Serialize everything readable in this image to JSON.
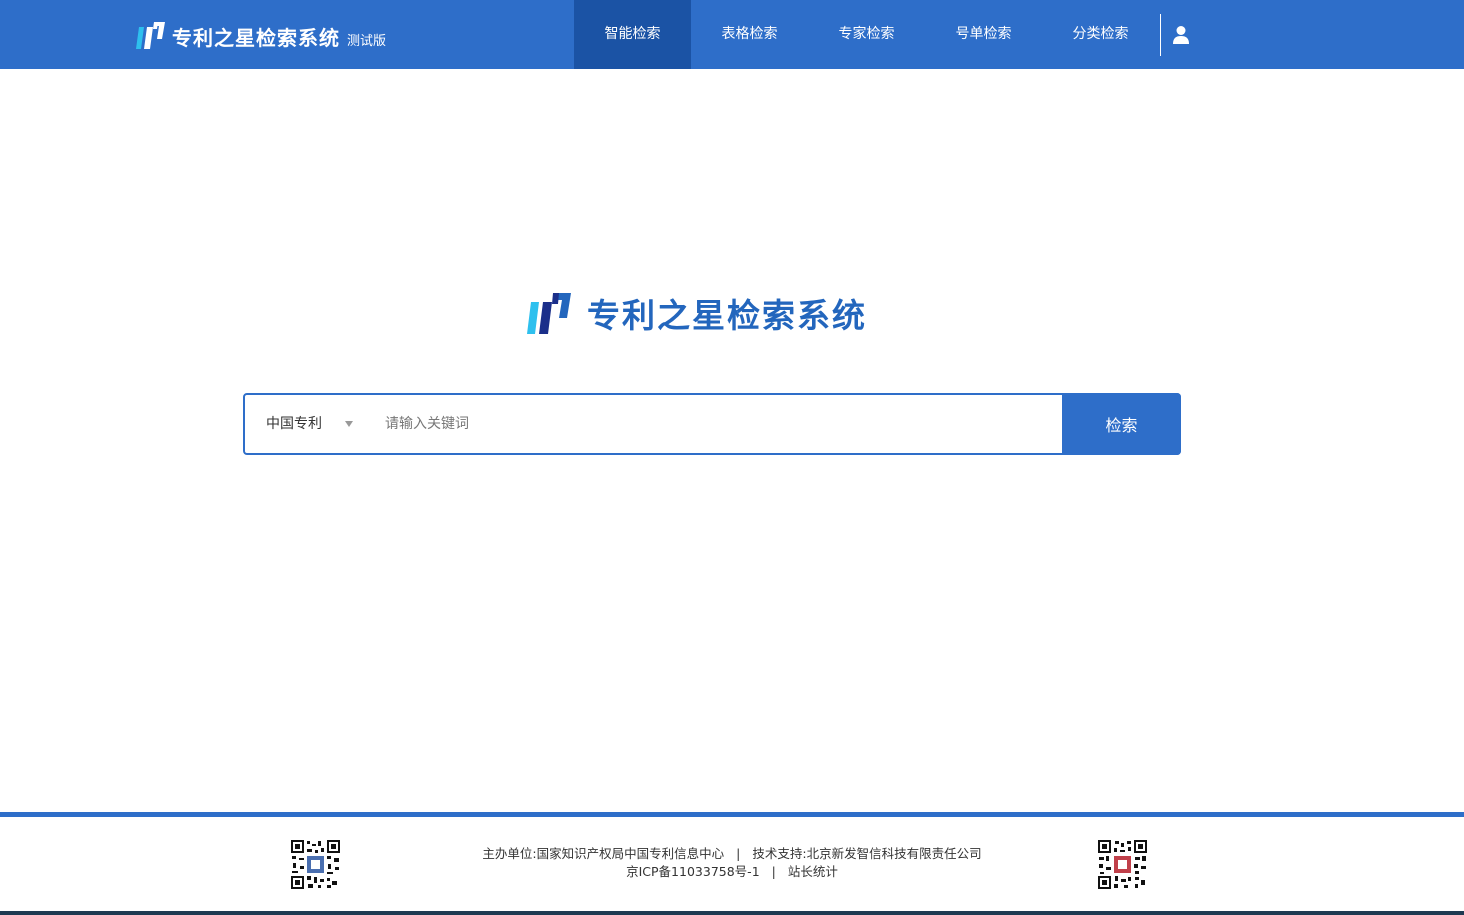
{
  "header": {
    "brand_name": "专利之星检索系统",
    "brand_tag": "测试版",
    "nav": [
      {
        "label": "智能检索",
        "active": true
      },
      {
        "label": "表格检索",
        "active": false
      },
      {
        "label": "专家检索",
        "active": false
      },
      {
        "label": "号单检索",
        "active": false
      },
      {
        "label": "分类检索",
        "active": false
      }
    ],
    "user_icon": "user-icon"
  },
  "main": {
    "logo_text": "专利之星检索系统"
  },
  "search": {
    "type_selected": "中国专利",
    "placeholder": "请输入关键词",
    "value": "",
    "button_label": "检索"
  },
  "footer": {
    "sponsor": "主办单位:国家知识产权局中国专利信息中心",
    "support": "技术支持:北京新发智信科技有限责任公司",
    "icp": "京ICP备11033758号-1",
    "stats": "站长统计",
    "separator": "|"
  },
  "colors": {
    "primary": "#2e6ec9",
    "nav_active": "#1b53a5",
    "logo_text": "#2366bd"
  }
}
